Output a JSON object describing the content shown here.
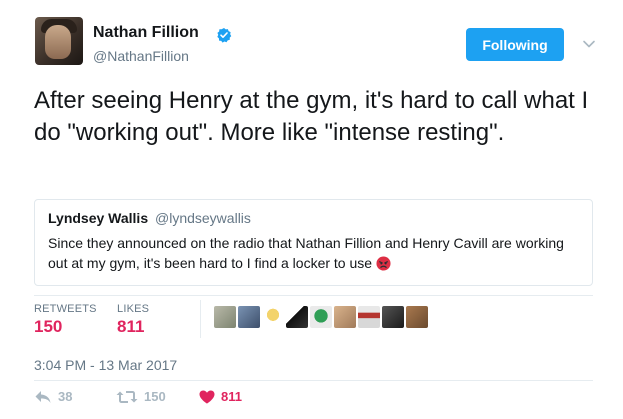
{
  "author": {
    "name": "Nathan Fillion",
    "handle": "@NathanFillion",
    "verified": true
  },
  "follow_button": {
    "label": "Following"
  },
  "tweet": {
    "text": "After seeing Henry at the gym, it's hard to call what I do \"working out\". More like \"intense resting\"."
  },
  "quoted_tweet": {
    "name": "Lyndsey Wallis",
    "handle": "@lyndseywallis",
    "text": "Since they announced on the radio that Nathan Fillion and Henry Cavill are working out at my gym, it's been hard to I find a locker to use"
  },
  "stats": {
    "retweets_label": "RETWEETS",
    "retweets_value": "150",
    "likes_label": "LIKES",
    "likes_value": "811"
  },
  "timestamp": "3:04 PM - 13 Mar 2017",
  "actions": {
    "reply_count": "38",
    "retweet_count": "150",
    "like_count": "811"
  },
  "colors": {
    "accent": "#1da1f2",
    "like": "#e0245e",
    "muted": "#657786"
  }
}
